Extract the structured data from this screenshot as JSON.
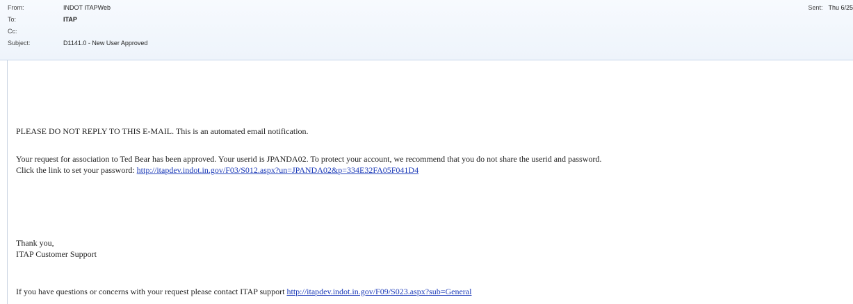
{
  "header": {
    "from_label": "From:",
    "from_value": "INDOT ITAPWeb",
    "to_label": "To:",
    "to_value": "ITAP",
    "cc_label": "Cc:",
    "cc_value": "",
    "subject_label": "Subject:",
    "subject_value": "D1141.0 - New User Approved",
    "sent_label": "Sent:",
    "sent_value": "Thu 6/25"
  },
  "body": {
    "notice": "PLEASE DO NOT REPLY TO THIS E-MAIL. This is an automated email notification.",
    "approval_line1": "Your request for association to Ted Bear has been approved. Your userid is JPANDA02. To protect your account, we recommend that you do not share the userid and password.",
    "approval_line2_prefix": "Click the link to set your password: ",
    "password_link": "http://itapdev.indot.in.gov/F03/S012.aspx?un=JPANDA02&p=334E32FA05F041D4",
    "thanks": "Thank you,",
    "signature": "ITAP Customer Support",
    "contact_prefix": "If you have questions or concerns with your request please contact ITAP support ",
    "support_link": "http://itapdev.indot.in.gov/F09/S023.aspx?sub=General"
  }
}
